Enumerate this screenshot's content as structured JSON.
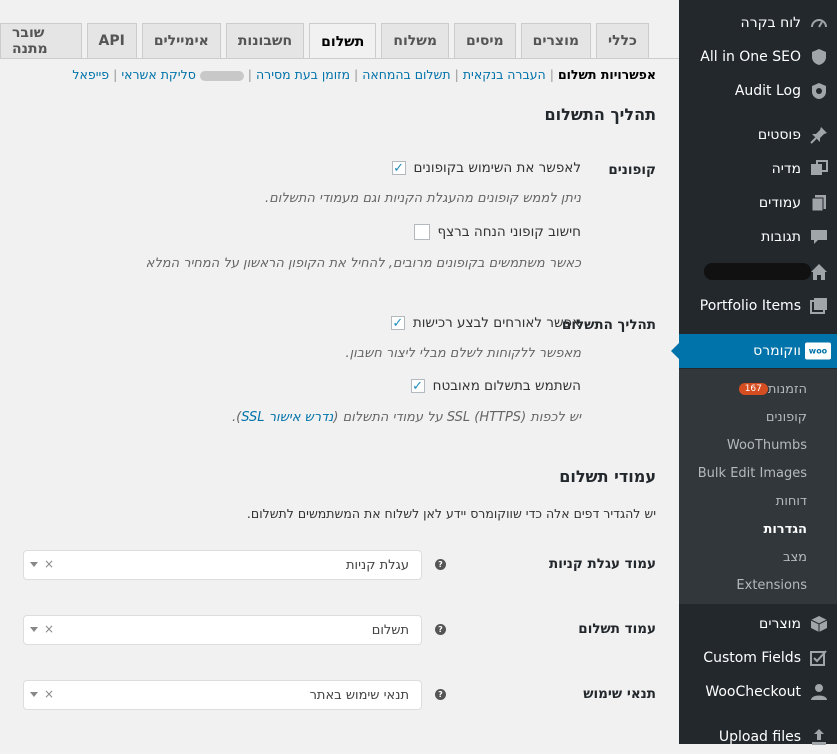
{
  "sidebar": {
    "items": [
      {
        "label": "לוח בקרה",
        "icon": "dashboard-icon"
      },
      {
        "label": "All in One SEO",
        "icon": "shield-icon"
      },
      {
        "label": "Audit Log",
        "icon": "audit-log-icon"
      },
      {
        "label": "פוסטים",
        "icon": "pin-icon"
      },
      {
        "label": "מדיה",
        "icon": "media-icon"
      },
      {
        "label": "עמודים",
        "icon": "pages-icon"
      },
      {
        "label": "תגובות",
        "icon": "comments-icon"
      },
      {
        "label": "",
        "icon": "home-icon"
      },
      {
        "label": "Portfolio Items",
        "icon": "portfolio-icon"
      },
      {
        "label": "ווקומרס",
        "icon": "woo-icon"
      }
    ],
    "woo_logo": "woo",
    "submenu": [
      {
        "label": "הזמנות",
        "badge": "167"
      },
      {
        "label": "קופונים"
      },
      {
        "label": "WooThumbs"
      },
      {
        "label": "Bulk Edit Images"
      },
      {
        "label": "דוחות"
      },
      {
        "label": "הגדרות"
      },
      {
        "label": "מצב"
      },
      {
        "label": "Extensions"
      }
    ],
    "bottom_items": [
      {
        "label": "מוצרים",
        "icon": "box-icon"
      },
      {
        "label": "Custom Fields",
        "icon": "checkbox-icon"
      },
      {
        "label": "WooCheckout",
        "icon": "user-icon"
      },
      {
        "label": "Upload files",
        "icon": "upload-icon"
      }
    ]
  },
  "tabs": [
    "כללי",
    "מוצרים",
    "מיסים",
    "משלוח",
    "תשלום",
    "חשבונות",
    "אימיילים",
    "API",
    "שובר מתנה"
  ],
  "active_tab": "תשלום",
  "subnav": {
    "current": "אפשרויות תשלום",
    "links": [
      "העברה בנקאית",
      "תשלום בהמחאה",
      "מזומן בעת מסירה",
      "סליקת אשראי",
      "פייפאל"
    ]
  },
  "section1": {
    "title": "תהליך התשלום",
    "coupons_label": "קופונים",
    "enable_coupons": "לאפשר את השימוש בקופונים",
    "enable_coupons_desc": "ניתן לממש קופונים מהעגלת הקניות וגם מעמודי התשלום.",
    "sequential_coupons": "חישוב קופוני הנחה ברצף",
    "sequential_coupons_desc": "כאשר משתמשים בקופונים מרובים, להחיל את הקופון הראשון על המחיר המלא",
    "checkout_label": "תהליך התשלום",
    "guest_checkout": "אפשר לאורחים לבצע רכישות",
    "guest_checkout_desc": "מאפשר ללקוחות לשלם מבלי ליצור חשבון.",
    "secure_checkout": "השתמש בתשלום מאובטח",
    "secure_checkout_desc_pre": "יש לכפות SSL (HTTPS) על עמודי התשלום (",
    "secure_checkout_link": "נדרש אישור SSL",
    "secure_checkout_desc_post": ")."
  },
  "section2": {
    "title": "עמודי תשלום",
    "intro": "יש להגדיר דפים אלה כדי שווקומרס יידע לאן לשלוח את המשתמשים לתשלום.",
    "fields": [
      {
        "label": "עמוד עגלת קניות",
        "value": "עגלת קניות"
      },
      {
        "label": "עמוד תשלום",
        "value": "תשלום"
      },
      {
        "label": "תנאי שימוש",
        "value": "תנאי שימוש באתר"
      }
    ]
  },
  "colors": {
    "sidebar": "#23282d",
    "accent": "#0073aa",
    "badge": "#d54e21"
  }
}
